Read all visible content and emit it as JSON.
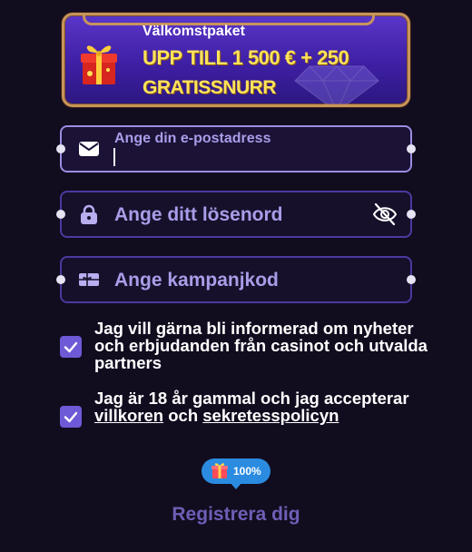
{
  "banner": {
    "welcome": "Välkomstpaket",
    "offer": "UPP TILL 1 500 € + 250",
    "spins": "GRATISSNURR"
  },
  "email_field": {
    "label": "Ange din e-postadress",
    "value": ""
  },
  "password_field": {
    "placeholder": "Ange ditt lösenord"
  },
  "promo_field": {
    "placeholder": "Ange kampanjkod"
  },
  "consents": {
    "marketing": {
      "checked": true,
      "text": "Jag vill gärna bli informerad om nyheter och erbjudanden från casinot och utvalda partners"
    },
    "age_terms": {
      "checked": true,
      "text_before": "Jag är 18 år gammal och jag accepterar ",
      "terms_link": "villkoren",
      "text_middle": " och ",
      "privacy_link": "sekretesspolicyn"
    }
  },
  "progress_badge": {
    "percent": 100,
    "label": "100%"
  },
  "register_button": {
    "label": "Registrera dig"
  },
  "colors": {
    "background": "#120c1f",
    "field_border": "#4a3aa0",
    "placeholder": "#a99de8",
    "checkbox": "#6e5ad6",
    "banner_text": "#ffe35a",
    "badge": "#2a8be0",
    "register_text": "#6f5eb6"
  },
  "icons": [
    "gift-box-icon",
    "diamond-icon",
    "envelope-icon",
    "lock-icon",
    "eye-off-icon",
    "ticket-icon",
    "checkmark-icon",
    "gift-icon"
  ]
}
